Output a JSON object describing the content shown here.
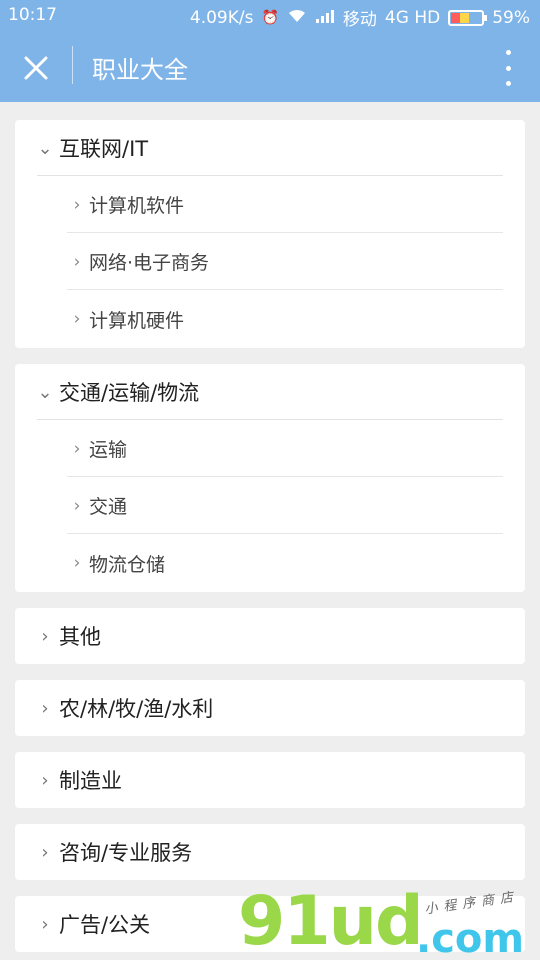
{
  "status_bar": {
    "time": "10:17",
    "network_speed": "4.09K/s",
    "carrier": "移动",
    "network_type": "4G HD",
    "battery": "59%"
  },
  "header": {
    "title": "职业大全",
    "close_icon": "close-icon",
    "more_icon": "more-vertical-icon"
  },
  "categories": [
    {
      "label": "互联网/IT",
      "expanded": true,
      "children": [
        "计算机软件",
        "网络·电子商务",
        "计算机硬件"
      ]
    },
    {
      "label": "交通/运输/物流",
      "expanded": true,
      "children": [
        "运输",
        "交通",
        "物流仓储"
      ]
    },
    {
      "label": "其他",
      "expanded": false
    },
    {
      "label": "农/林/牧/渔/水利",
      "expanded": false
    },
    {
      "label": "制造业",
      "expanded": false
    },
    {
      "label": "咨询/专业服务",
      "expanded": false
    },
    {
      "label": "广告/公关",
      "expanded": false
    }
  ],
  "watermark": {
    "main": "91ud",
    "suffix": ".com",
    "tagline": "小程序商店"
  },
  "colors": {
    "header_bg": "#7fb4e8",
    "page_bg": "#eeeeee",
    "card_bg": "#ffffff"
  }
}
